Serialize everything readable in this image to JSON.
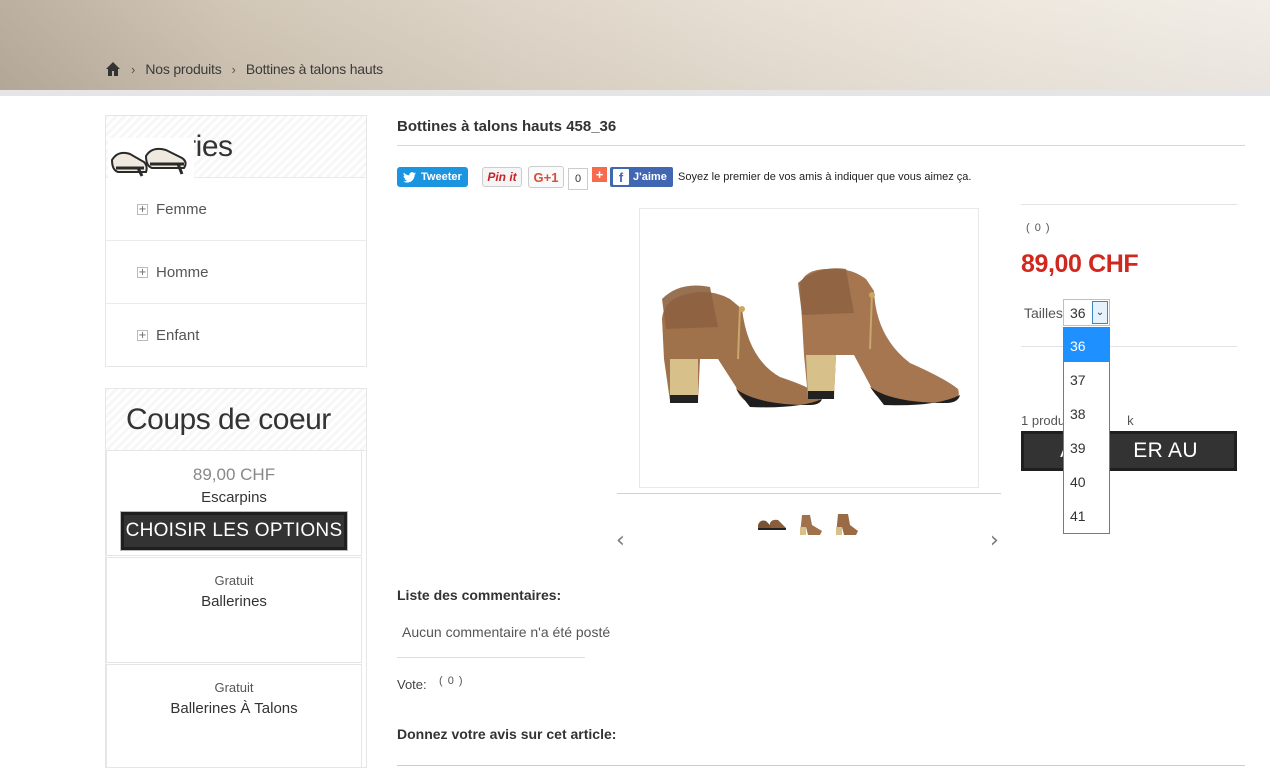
{
  "breadcrumb": {
    "home_icon": "home-icon",
    "items": [
      "Nos produits",
      "Bottines à talons hauts"
    ]
  },
  "categories": {
    "title_visible": "ories",
    "items": [
      "Femme",
      "Homme",
      "Enfant"
    ]
  },
  "favorites": {
    "title": "Coups de coeur",
    "products": [
      {
        "price": "89,00 CHF",
        "name": "Escarpins",
        "button": "CHOISIR LES OPTIONS"
      },
      {
        "price": "Gratuit",
        "name": "Ballerines"
      },
      {
        "price": "Gratuit",
        "name": "Ballerines À Talons"
      }
    ]
  },
  "product": {
    "title": "Bottines à talons hauts 458_36",
    "rating": "( 0 )",
    "price": "89,00 CHF",
    "size_label": "Tailles",
    "size_selected": "36",
    "size_options": [
      "36",
      "37",
      "38",
      "39",
      "40",
      "41"
    ],
    "stock_visible": "1 produ",
    "stock_tail": "k",
    "cart_button_left": "AJ",
    "cart_button_right": "ER AU PANIER"
  },
  "social": {
    "tweet": "Tweeter",
    "pin": "Pin it",
    "gplus": "G+1",
    "gplus_count": "0",
    "addthis": "+",
    "fb_like": "J'aime",
    "fb_text": "Soyez le premier de vos amis à indiquer que vous aimez ça."
  },
  "comments": {
    "title": "Liste des commentaires:",
    "empty": "Aucun commentaire n'a été posté",
    "vote_label": "Vote:",
    "vote_value": "( 0 )",
    "review_title": "Donnez votre avis sur cet article:"
  },
  "colors": {
    "price_red": "#d0281f",
    "button_dark": "#333333",
    "dropdown_selected": "#1e90ff",
    "twitter": "#1b95e0",
    "facebook": "#4267b2"
  }
}
